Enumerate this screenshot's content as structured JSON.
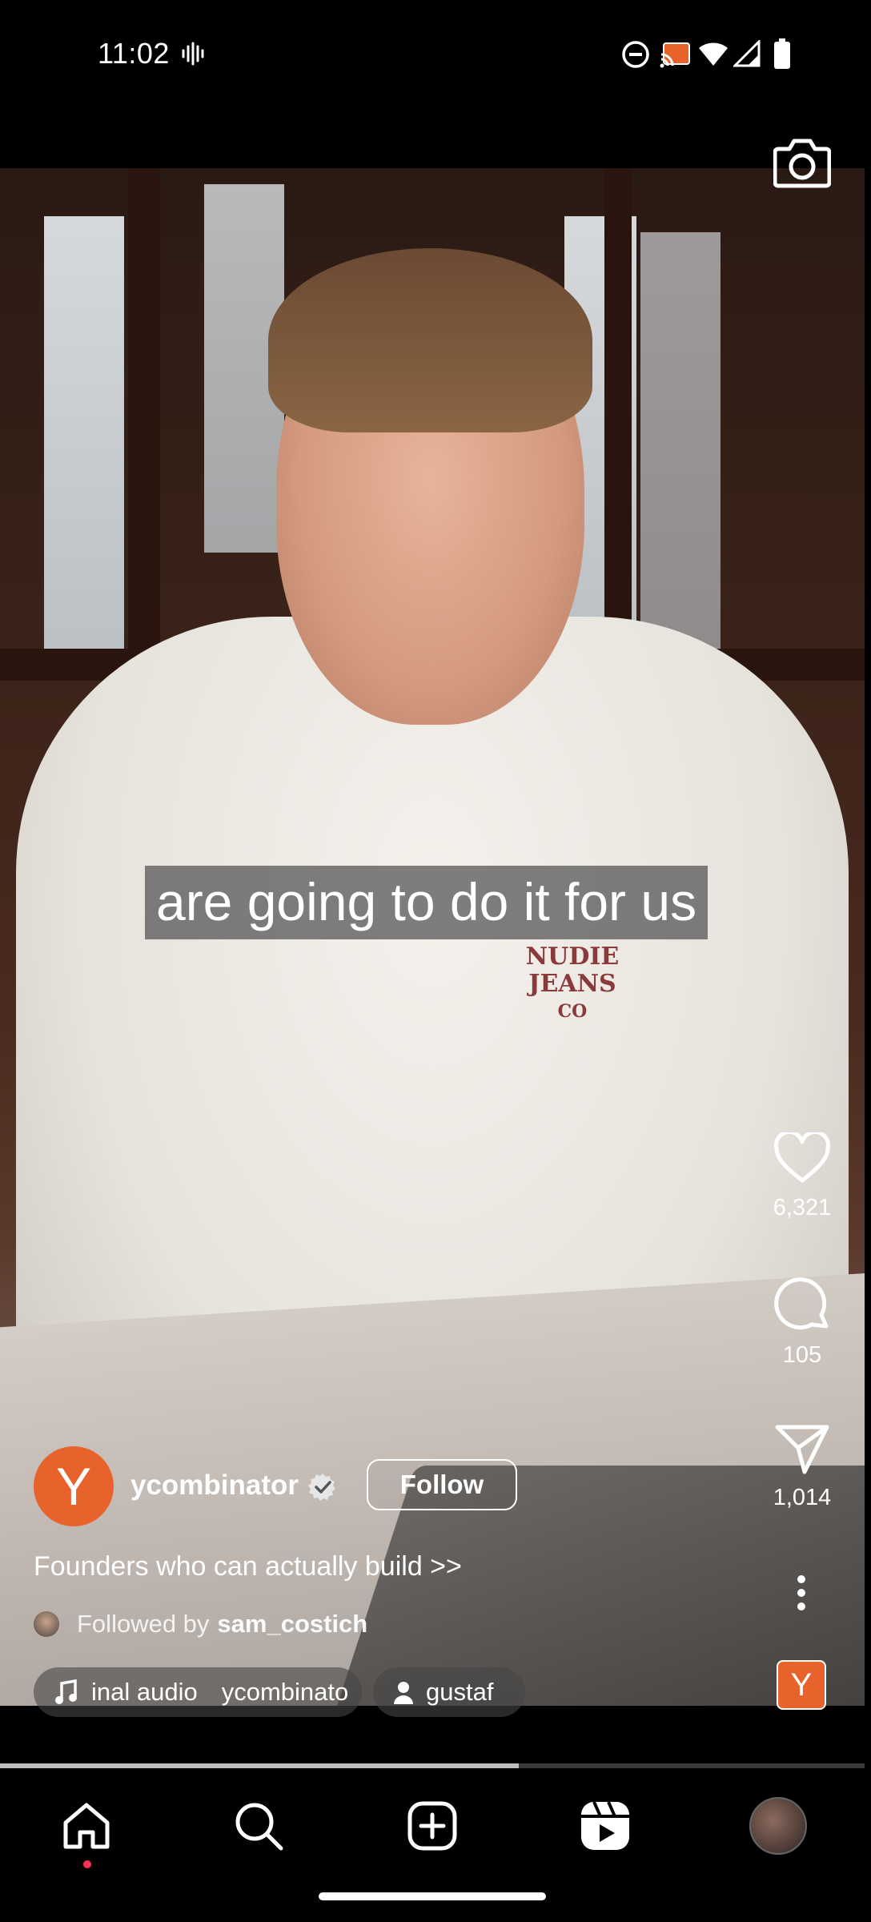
{
  "status_bar": {
    "time": "11:02",
    "icons": [
      "vibrate-icon",
      "dnd-icon",
      "cast-icon",
      "wifi-icon",
      "signal-icon",
      "battery-icon"
    ]
  },
  "video": {
    "caption": "are going to do it for us",
    "shirt_print": [
      "NUDIE",
      "JEANS",
      "CO"
    ]
  },
  "rail": {
    "likes": "6,321",
    "comments": "105",
    "shares": "1,014",
    "audio_avatar_letter": "Y"
  },
  "post": {
    "avatar_letter": "Y",
    "username": "ycombinator",
    "follow_label": "Follow",
    "description": "Founders who can actually build >>",
    "followed_by_prefix": "Followed by",
    "followed_by_user": "sam_costich",
    "audio_text": "inal audio",
    "audio_owner": "ycombinato",
    "tagged_user": "gustaf"
  },
  "progress": {
    "fraction": 0.6
  },
  "nav": {
    "items": [
      "home-icon",
      "search-icon",
      "create-icon",
      "reels-icon",
      "profile-avatar"
    ],
    "active": "reels"
  },
  "colors": {
    "brand_orange": "#e8622b",
    "notification_red": "#ff2d55"
  }
}
